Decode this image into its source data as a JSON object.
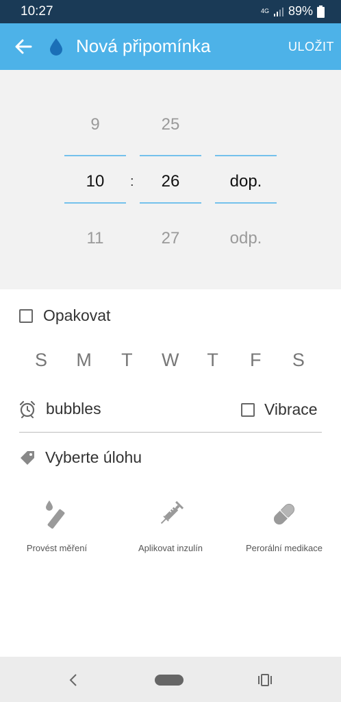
{
  "status": {
    "time": "10:27",
    "network": "4G",
    "battery": "89%"
  },
  "header": {
    "title": "Nová připomínka",
    "save_label": "ULOŽIT"
  },
  "picker": {
    "hours": {
      "prev": "9",
      "current": "10",
      "next": "11"
    },
    "separator": ":",
    "minutes": {
      "prev": "25",
      "current": "26",
      "next": "27"
    },
    "period": {
      "prev": "",
      "current": "dop.",
      "next": "odp."
    }
  },
  "repeat": {
    "label": "Opakovat",
    "checked": false
  },
  "days": [
    "S",
    "M",
    "T",
    "W",
    "T",
    "F",
    "S"
  ],
  "sound": {
    "label": "bubbles"
  },
  "vibration": {
    "label": "Vibrace",
    "checked": false
  },
  "task": {
    "label": "Vyberte úlohu"
  },
  "tasks": [
    {
      "label": "Provést měření",
      "icon": "measure-icon"
    },
    {
      "label": "Aplikovat inzulín",
      "icon": "syringe-icon"
    },
    {
      "label": "Perorální medikace",
      "icon": "pill-icon"
    }
  ],
  "colors": {
    "status_bar": "#1a3a56",
    "app_bar": "#4db2e8",
    "picker_line": "#74c1ec"
  }
}
